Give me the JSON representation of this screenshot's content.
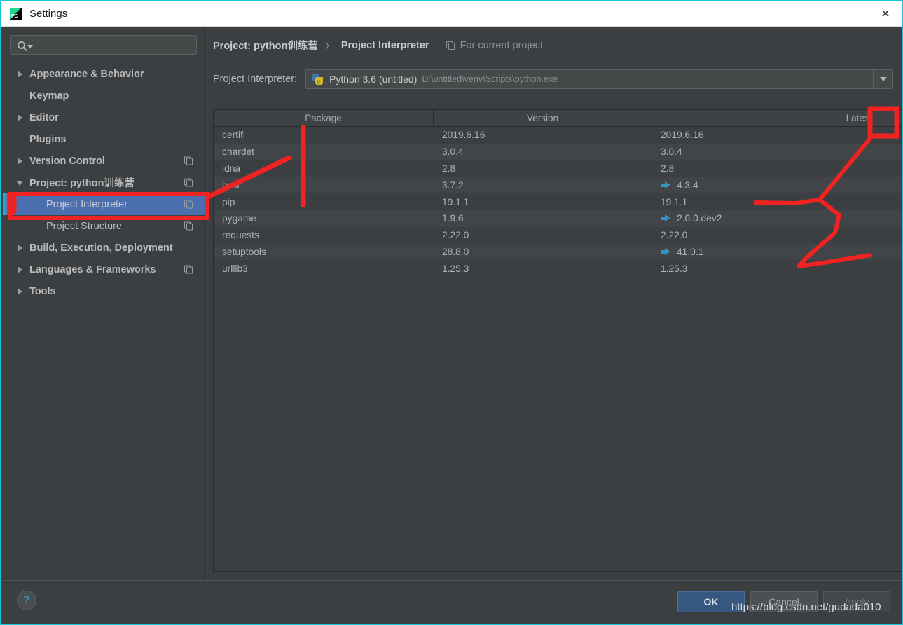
{
  "window": {
    "title": "Settings",
    "app_icon": "pycharm-icon",
    "close_label": "✕",
    "accent_border": "#19c8d4"
  },
  "search": {
    "placeholder": "",
    "value": "",
    "icon": "search-icon"
  },
  "sidebar": {
    "items": [
      {
        "label": "Appearance & Behavior",
        "twisty": "closed",
        "level": 0,
        "bold": true,
        "copy_icon": false,
        "selected": false
      },
      {
        "label": "Keymap",
        "twisty": "none",
        "level": 0,
        "bold": true,
        "copy_icon": false,
        "selected": false
      },
      {
        "label": "Editor",
        "twisty": "closed",
        "level": 0,
        "bold": true,
        "copy_icon": false,
        "selected": false
      },
      {
        "label": "Plugins",
        "twisty": "none",
        "level": 0,
        "bold": true,
        "copy_icon": false,
        "selected": false
      },
      {
        "label": "Version Control",
        "twisty": "closed",
        "level": 0,
        "bold": true,
        "copy_icon": true,
        "selected": false
      },
      {
        "label": "Project: python训练营",
        "twisty": "open",
        "level": 0,
        "bold": true,
        "copy_icon": true,
        "selected": false
      },
      {
        "label": "Project Interpreter",
        "twisty": "none",
        "level": 1,
        "bold": false,
        "copy_icon": true,
        "selected": true
      },
      {
        "label": "Project Structure",
        "twisty": "none",
        "level": 1,
        "bold": false,
        "copy_icon": true,
        "selected": false
      },
      {
        "label": "Build, Execution, Deployment",
        "twisty": "closed",
        "level": 0,
        "bold": true,
        "copy_icon": false,
        "selected": false
      },
      {
        "label": "Languages & Frameworks",
        "twisty": "closed",
        "level": 0,
        "bold": true,
        "copy_icon": true,
        "selected": false
      },
      {
        "label": "Tools",
        "twisty": "closed",
        "level": 0,
        "bold": true,
        "copy_icon": false,
        "selected": false
      }
    ]
  },
  "breadcrumb": {
    "project": "Project: python训练营",
    "separator": "〉",
    "page": "Project Interpreter",
    "note": "For current project",
    "note_icon": "copy-settings-icon"
  },
  "interpreter": {
    "label": "Project Interpreter:",
    "icon": "python-venv-icon",
    "name": "Python 3.6 (untitled)",
    "path": "D:\\untitled\\venv\\Scripts\\python.exe",
    "dropdown_icon": "chevron-down-icon",
    "gear_icon": "gear-icon"
  },
  "packages_table": {
    "columns": [
      "Package",
      "Version",
      "Latest"
    ],
    "rows": [
      {
        "package": "certifi",
        "version": "2019.6.16",
        "latest": "2019.6.16",
        "upgradable": false
      },
      {
        "package": "chardet",
        "version": "3.0.4",
        "latest": "3.0.4",
        "upgradable": false
      },
      {
        "package": "idna",
        "version": "2.8",
        "latest": "2.8",
        "upgradable": false
      },
      {
        "package": "lxml",
        "version": "3.7.2",
        "latest": "4.3.4",
        "upgradable": true
      },
      {
        "package": "pip",
        "version": "19.1.1",
        "latest": "19.1.1",
        "upgradable": false
      },
      {
        "package": "pygame",
        "version": "1.9.6",
        "latest": "2.0.0.dev2",
        "upgradable": true
      },
      {
        "package": "requests",
        "version": "2.22.0",
        "latest": "2.22.0",
        "upgradable": false
      },
      {
        "package": "setuptools",
        "version": "28.8.0",
        "latest": "41.0.1",
        "upgradable": true
      },
      {
        "package": "urllib3",
        "version": "1.25.3",
        "latest": "1.25.3",
        "upgradable": false
      }
    ],
    "tools": [
      {
        "name": "add-package-button",
        "icon": "plus-icon",
        "enabled": true
      },
      {
        "name": "remove-package-button",
        "icon": "minus-icon",
        "enabled": false
      },
      {
        "name": "upgrade-package-button",
        "icon": "up-arrow-icon",
        "enabled": false
      }
    ]
  },
  "footer": {
    "help_label": "?",
    "ok_label": "OK",
    "cancel_label": "Cancel",
    "apply_label": "Apply"
  },
  "watermark": {
    "text": "https://blog.csdn.net/gudada010"
  },
  "annotations": {
    "color": "#f12222",
    "highlight_target": "Project Interpreter sidebar entry",
    "callout_target": "add package (+) button"
  }
}
